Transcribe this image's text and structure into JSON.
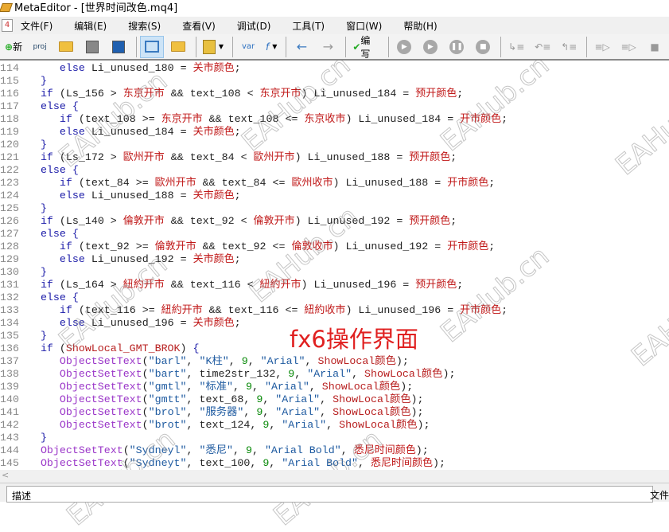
{
  "window": {
    "title": "MetaEditor - [世界时间改色.mq4]"
  },
  "menu": [
    {
      "label": "文件(F)"
    },
    {
      "label": "编辑(E)"
    },
    {
      "label": "搜索(S)"
    },
    {
      "label": "查看(V)"
    },
    {
      "label": "调试(D)"
    },
    {
      "label": "工具(T)"
    },
    {
      "label": "窗口(W)"
    },
    {
      "label": "帮助(H)"
    }
  ],
  "toolbar": {
    "new_label": "新",
    "compile_label": "编写",
    "var_label": "var",
    "proj_label": "proj",
    "f_label": "f"
  },
  "editor": {
    "lines": [
      {
        "no": "114",
        "code": "      else Li_unused_180 = 关市颜色;"
      },
      {
        "no": "115",
        "code": "   }"
      },
      {
        "no": "116",
        "code": "   if (Ls_156 > 东京开市 && text_108 < 东京开市) Li_unused_184 = 预开颜色;"
      },
      {
        "no": "117",
        "code": "   else {"
      },
      {
        "no": "118",
        "code": "      if (text_108 >= 东京开市 && text_108 <= 东京收市) Li_unused_184 = 开市颜色;"
      },
      {
        "no": "119",
        "code": "      else Li_unused_184 = 关市颜色;"
      },
      {
        "no": "120",
        "code": "   }"
      },
      {
        "no": "121",
        "code": "   if (Ls_172 > 歐州开市 && text_84 < 歐州开市) Li_unused_188 = 预开颜色;"
      },
      {
        "no": "122",
        "code": "   else {"
      },
      {
        "no": "123",
        "code": "      if (text_84 >= 歐州开市 && text_84 <= 歐州收市) Li_unused_188 = 开市颜色;"
      },
      {
        "no": "124",
        "code": "      else Li_unused_188 = 关市颜色;"
      },
      {
        "no": "125",
        "code": "   }"
      },
      {
        "no": "126",
        "code": "   if (Ls_140 > 倫敦开市 && text_92 < 倫敦开市) Li_unused_192 = 预开颜色;"
      },
      {
        "no": "127",
        "code": "   else {"
      },
      {
        "no": "128",
        "code": "      if (text_92 >= 倫敦开市 && text_92 <= 倫敦收市) Li_unused_192 = 开市颜色;"
      },
      {
        "no": "129",
        "code": "      else Li_unused_192 = 关市颜色;"
      },
      {
        "no": "130",
        "code": "   }"
      },
      {
        "no": "131",
        "code": "   if (Ls_164 > 紐約开市 && text_116 < 紐約开市) Li_unused_196 = 预开颜色;"
      },
      {
        "no": "132",
        "code": "   else {"
      },
      {
        "no": "133",
        "code": "      if (text_116 >= 紐約开市 && text_116 <= 紐約收市) Li_unused_196 = 开市颜色;"
      },
      {
        "no": "134",
        "code": "      else Li_unused_196 = 关市颜色;"
      },
      {
        "no": "135",
        "code": "   }"
      },
      {
        "no": "136",
        "code": "   if (ShowLocal_GMT_BROK) {"
      },
      {
        "no": "137",
        "code": "      ObjectSetText(\"barl\", \"K柱\", 9, \"Arial\", ShowLocal颜色);"
      },
      {
        "no": "138",
        "code": "      ObjectSetText(\"bart\", time2str_132, 9, \"Arial\", ShowLocal颜色);"
      },
      {
        "no": "139",
        "code": "      ObjectSetText(\"gmtl\", \"标准\", 9, \"Arial\", ShowLocal颜色);"
      },
      {
        "no": "140",
        "code": "      ObjectSetText(\"gmtt\", text_68, 9, \"Arial\", ShowLocal颜色);"
      },
      {
        "no": "141",
        "code": "      ObjectSetText(\"brol\", \"服务器\", 9, \"Arial\", ShowLocal颜色);"
      },
      {
        "no": "142",
        "code": "      ObjectSetText(\"brot\", text_124, 9, \"Arial\", ShowLocal颜色);"
      },
      {
        "no": "143",
        "code": "   }"
      },
      {
        "no": "144",
        "code": "   ObjectSetText(\"Sydneyl\", \"悉尼\", 9, \"Arial Bold\", 悉尼时间颜色);"
      },
      {
        "no": "145",
        "code": "   ObjectSetText(\"Sydneyt\", text_100, 9, \"Arial Bold\", 悉尼时间颜色);"
      }
    ]
  },
  "overlay_caption": "fx6操作界面",
  "watermark": "EAHub.cn",
  "bottom": {
    "tab_label": "描述",
    "right_label": "文件"
  },
  "colors": {
    "keyword": "#1b1ba8",
    "identifier_cn": "#c01818",
    "string": "#1e5aa0",
    "number": "#0a8a0a",
    "function": "#9a35c8",
    "caption": "#e02020"
  }
}
